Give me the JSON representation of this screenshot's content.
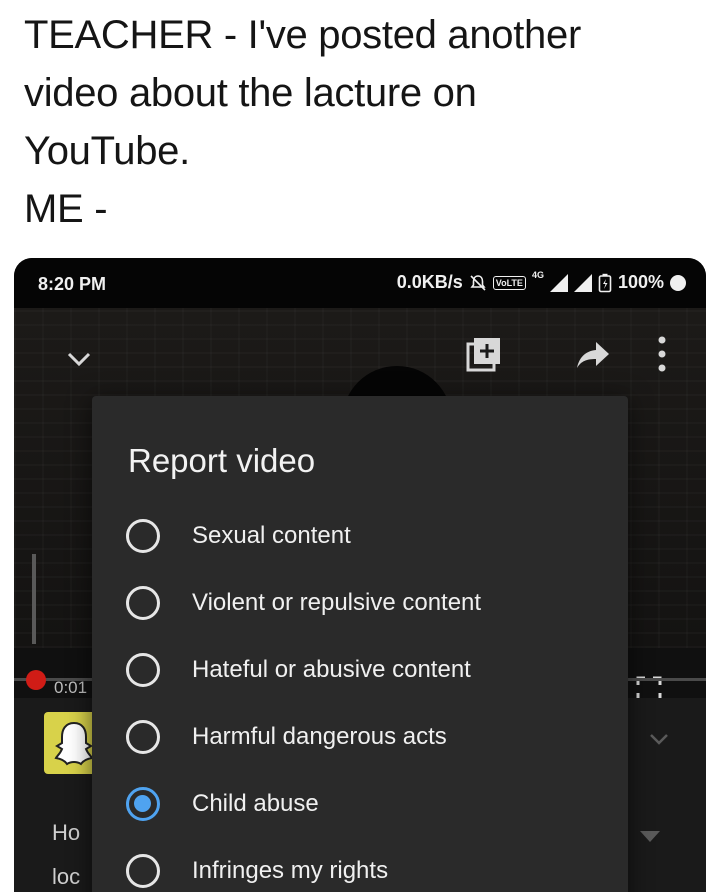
{
  "caption": {
    "lines": [
      "TEACHER - I've posted another",
      "video about the lacture on",
      "YouTube.",
      "ME -"
    ]
  },
  "status_bar": {
    "time": "8:20 PM",
    "speed": "0.0KB/s",
    "network": "4G",
    "volte": "VoLTE",
    "battery": "100%"
  },
  "player": {
    "elapsed": "0:01",
    "progress_fraction": 0.01,
    "peek_text_1": "Ho",
    "peek_text_2": "loc"
  },
  "report_dialog": {
    "title": "Report video",
    "options": [
      {
        "label": "Sexual content",
        "selected": false
      },
      {
        "label": "Violent or repulsive content",
        "selected": false
      },
      {
        "label": "Hateful or abusive content",
        "selected": false
      },
      {
        "label": "Harmful dangerous acts",
        "selected": false
      },
      {
        "label": "Child abuse",
        "selected": true
      },
      {
        "label": "Infringes my rights",
        "selected": false
      }
    ]
  },
  "colors": {
    "accent_radio": "#4fa3f0",
    "progress_red": "#d01c16",
    "dialog_bg": "#2a2a2a"
  }
}
